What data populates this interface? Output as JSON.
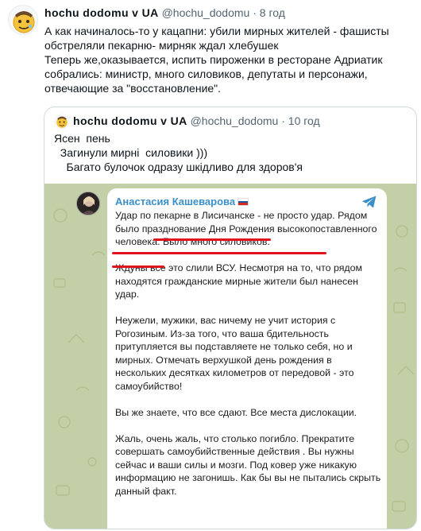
{
  "tweet": {
    "author_name": "hochu dodomu v UA",
    "handle": "@hochu_dodomu",
    "separator": "·",
    "time": "8 год",
    "text": "А как начиналось-то у кацапни: убили мирных жителей - фашисты обстреляли пекарню- мирняк ждал хлебушек\nТеперь же,оказывается, испить пироженки в ресторане Адриатик собрались: министр, много силовиков, депутаты и персонажи, отвечающие за \"восстановление\"."
  },
  "quote": {
    "author_name": "hochu dodomu v UA",
    "handle": "@hochu_dodomu",
    "separator": "·",
    "time": "10 год",
    "text": "Ясен  пень\n  Загинули мирні  силовики )))\n    Багато булочок одразу шкідливо для здоров'я"
  },
  "telegram_post": {
    "author_name": "Анастасия Кашеварова",
    "paragraphs": [
      "Удар по пекарне в Лисичанске - не просто удар. Рядом было празднование Дня Рождения высокопоставленного человека. Было много силовиков.",
      "Ждуны все это слили ВСУ. Несмотря на то, что рядом находятся гражданские мирные жители был нанесен удар.",
      "Неужели, мужики, вас ничему не учит история с Рогозиным. Из-за того, что ваша бдительность притупляется вы подставляете не только себя, но и мирных. Отмечать верхушкой день рождения в нескольких десятках километров от передовой - это самоубийство!",
      "Вы же знаете, что все сдают. Все места дислокации.",
      "Жаль, очень жаль, что столько погибло. Прекратите совершать самоубийственные действия . Вы нужны сейчас и ваши силы и мозги. Под ковер уже никакую информацию не загонишь. Как бы вы не пытались скрыть данный факт."
    ]
  },
  "colors": {
    "telegram_name": "#3a8fc7",
    "highlight_underline": "#e0141e",
    "chat_background": "#c3cfa6",
    "muted_text": "#536471"
  },
  "icons": [
    "emoji-face-avatar-icon",
    "russia-flag-icon",
    "telegram-plane-icon"
  ]
}
